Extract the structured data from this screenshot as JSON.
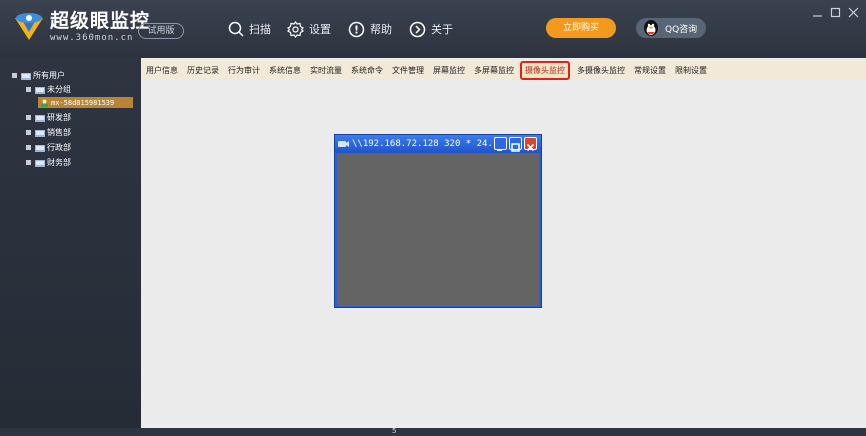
{
  "app": {
    "brand_name": "超级眼监控",
    "brand_url": "www.360mon.cn",
    "trial_label": "试用版"
  },
  "nav": {
    "scan": "扫描",
    "settings": "设置",
    "help": "帮助",
    "about": "关于"
  },
  "actions": {
    "buy": "立即购买",
    "qq": "QQ咨询"
  },
  "tree": {
    "root": "所有用户",
    "groups": [
      "未分组",
      "研发部",
      "销售部",
      "行政部",
      "财务部"
    ],
    "selected_user": "mx-58d815981539"
  },
  "tabs": [
    "用户信息",
    "历史记录",
    "行为审计",
    "系统信息",
    "实时流量",
    "系统命令",
    "文件管理",
    "屏幕监控",
    "多屏幕监控",
    "摄像头监控",
    "多摄像头监控",
    "常规设置",
    "限制设置"
  ],
  "active_tab": "摄像头监控",
  "camera_window": {
    "title": "\\\\192.168.72.128 320 * 24..."
  },
  "status": {
    "text": "5"
  },
  "colors": {
    "accent_orange": "#f39a1e",
    "active_tab_border": "#e0221d",
    "selected_row": "#b88534",
    "camera_frame": "#2a5fd3"
  }
}
